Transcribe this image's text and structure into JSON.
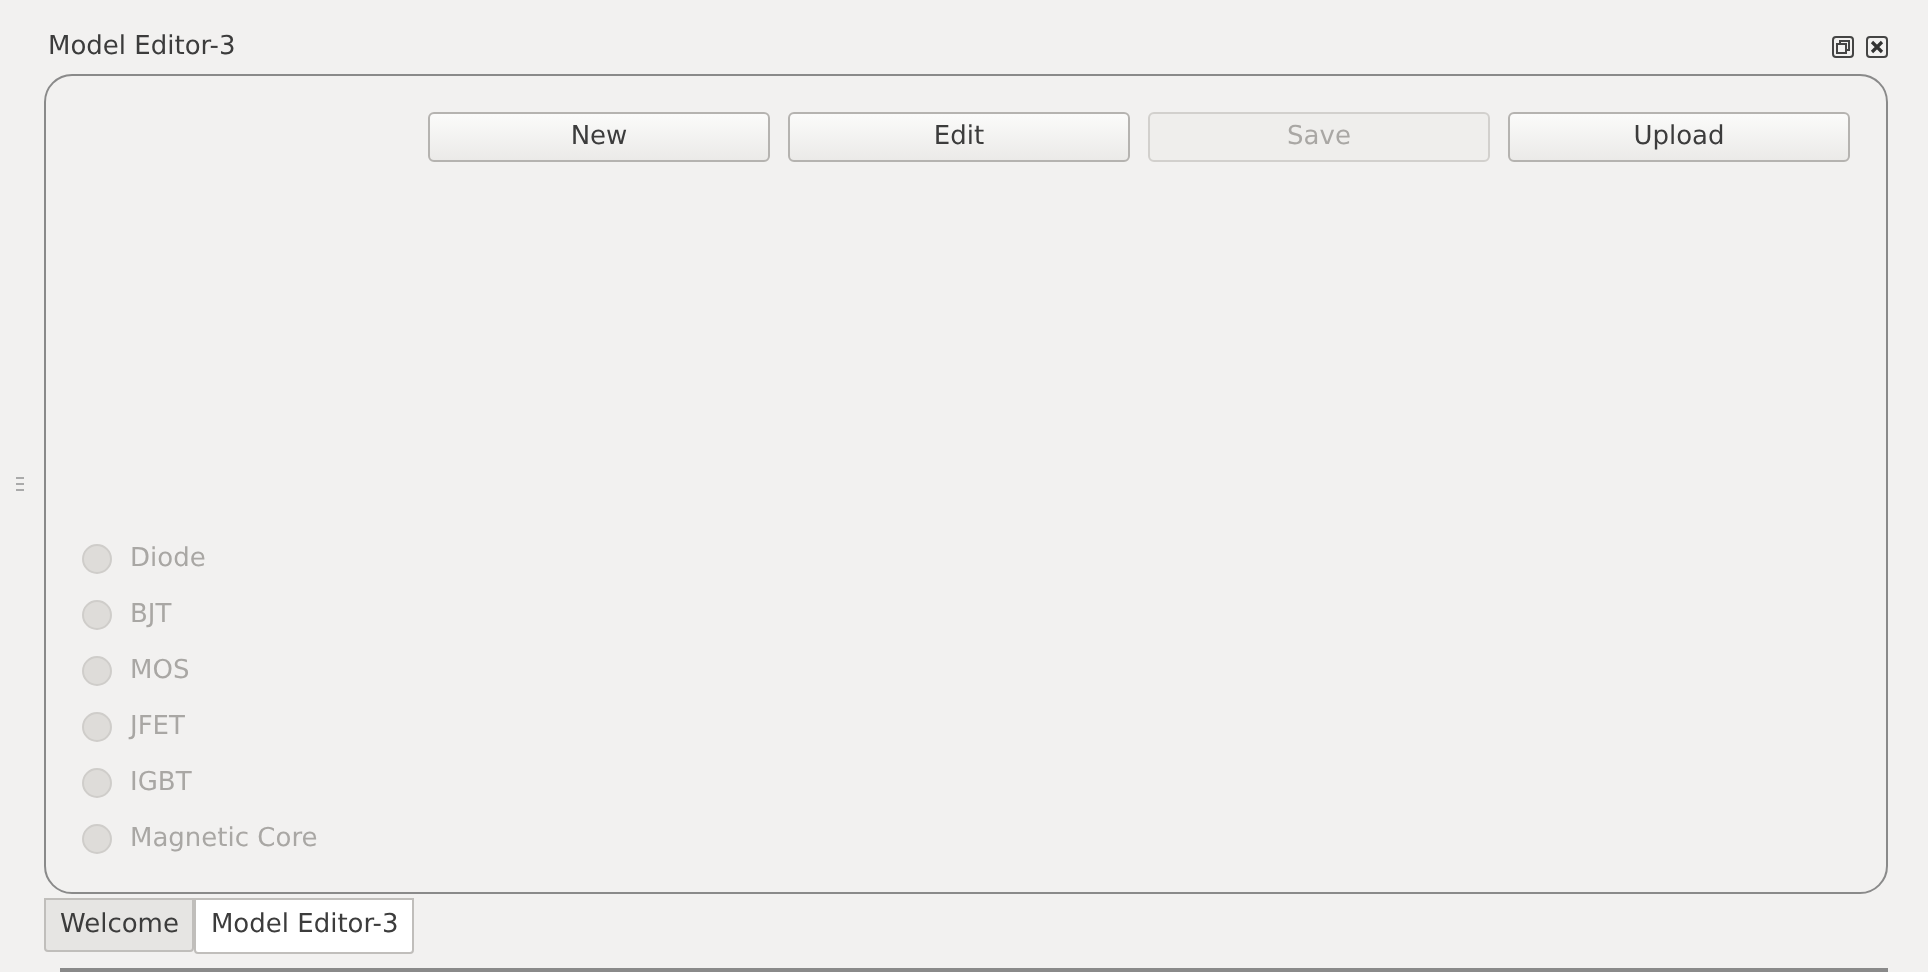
{
  "window": {
    "title": "Model Editor-3"
  },
  "buttons": [
    {
      "label": "New",
      "disabled": false
    },
    {
      "label": "Edit",
      "disabled": false
    },
    {
      "label": "Save",
      "disabled": true
    },
    {
      "label": "Upload",
      "disabled": false
    }
  ],
  "device_types": [
    {
      "label": "Diode",
      "checked": false,
      "disabled": true
    },
    {
      "label": "BJT",
      "checked": false,
      "disabled": true
    },
    {
      "label": "MOS",
      "checked": false,
      "disabled": true
    },
    {
      "label": "JFET",
      "checked": false,
      "disabled": true
    },
    {
      "label": "IGBT",
      "checked": false,
      "disabled": true
    },
    {
      "label": "Magnetic Core",
      "checked": false,
      "disabled": true
    }
  ],
  "tabs": [
    {
      "label": "Welcome",
      "selected": false
    },
    {
      "label": "Model Editor-3",
      "selected": true
    }
  ]
}
